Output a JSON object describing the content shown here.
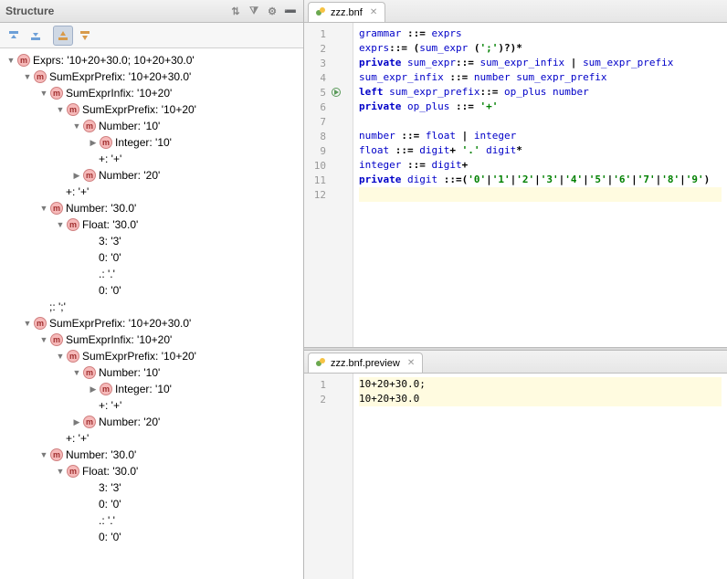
{
  "structure": {
    "title": "Structure",
    "tree": [
      {
        "d": 0,
        "a": "▼",
        "i": "m",
        "label": "Exprs: '10+20+30.0; 10+20+30.0'"
      },
      {
        "d": 1,
        "a": "▼",
        "i": "m",
        "label": "SumExprPrefix: '10+20+30.0'"
      },
      {
        "d": 2,
        "a": "▼",
        "i": "m",
        "label": "SumExprInfix: '10+20'"
      },
      {
        "d": 3,
        "a": "▼",
        "i": "m",
        "label": "SumExprPrefix: '10+20'"
      },
      {
        "d": 4,
        "a": "▼",
        "i": "m",
        "label": "Number: '10'"
      },
      {
        "d": 5,
        "a": "▶",
        "i": "m",
        "label": "Integer: '10'"
      },
      {
        "d": 4,
        "a": "",
        "i": "",
        "label": "+: '+'"
      },
      {
        "d": 4,
        "a": "▶",
        "i": "m",
        "label": "Number: '20'"
      },
      {
        "d": 2,
        "a": "",
        "i": "",
        "label": "+: '+'"
      },
      {
        "d": 2,
        "a": "▼",
        "i": "m",
        "label": "Number: '30.0'"
      },
      {
        "d": 3,
        "a": "▼",
        "i": "m",
        "label": "Float: '30.0'"
      },
      {
        "d": 4,
        "a": "",
        "i": "",
        "label": "3: '3'"
      },
      {
        "d": 4,
        "a": "",
        "i": "",
        "label": "0: '0'"
      },
      {
        "d": 4,
        "a": "",
        "i": "",
        "label": ".: '.'"
      },
      {
        "d": 4,
        "a": "",
        "i": "",
        "label": "0: '0'"
      },
      {
        "d": 1,
        "a": "",
        "i": "",
        "label": ";: ';'"
      },
      {
        "d": 1,
        "a": "▼",
        "i": "m",
        "label": "SumExprPrefix: '10+20+30.0'"
      },
      {
        "d": 2,
        "a": "▼",
        "i": "m",
        "label": "SumExprInfix: '10+20'"
      },
      {
        "d": 3,
        "a": "▼",
        "i": "m",
        "label": "SumExprPrefix: '10+20'"
      },
      {
        "d": 4,
        "a": "▼",
        "i": "m",
        "label": "Number: '10'"
      },
      {
        "d": 5,
        "a": "▶",
        "i": "m",
        "label": "Integer: '10'"
      },
      {
        "d": 4,
        "a": "",
        "i": "",
        "label": "+: '+'"
      },
      {
        "d": 4,
        "a": "▶",
        "i": "m",
        "label": "Number: '20'"
      },
      {
        "d": 2,
        "a": "",
        "i": "",
        "label": "+: '+'"
      },
      {
        "d": 2,
        "a": "▼",
        "i": "m",
        "label": "Number: '30.0'"
      },
      {
        "d": 3,
        "a": "▼",
        "i": "m",
        "label": "Float: '30.0'"
      },
      {
        "d": 4,
        "a": "",
        "i": "",
        "label": "3: '3'"
      },
      {
        "d": 4,
        "a": "",
        "i": "",
        "label": "0: '0'"
      },
      {
        "d": 4,
        "a": "",
        "i": "",
        "label": ".: '.'"
      },
      {
        "d": 4,
        "a": "",
        "i": "",
        "label": "0: '0'"
      }
    ]
  },
  "editor": {
    "tab_label": "zzz.bnf",
    "lines": [
      {
        "n": 1,
        "tokens": [
          [
            "ru",
            "grammar"
          ],
          [
            "op",
            " ::= "
          ],
          [
            "ru",
            "exprs"
          ]
        ]
      },
      {
        "n": 2,
        "tokens": [
          [
            "ru",
            "exprs"
          ],
          [
            "op",
            "::= ("
          ],
          [
            "ru",
            "sum_expr"
          ],
          [
            "op",
            " ("
          ],
          [
            "st",
            "';'"
          ],
          [
            "op",
            ")?)*"
          ]
        ]
      },
      {
        "n": 3,
        "tokens": [
          [
            "kw",
            "private "
          ],
          [
            "ru",
            "sum_expr"
          ],
          [
            "op",
            "::= "
          ],
          [
            "ru",
            "sum_expr_infix"
          ],
          [
            "op",
            " | "
          ],
          [
            "ru",
            "sum_expr_prefix"
          ]
        ]
      },
      {
        "n": 4,
        "tokens": [
          [
            "ru",
            "sum_expr_infix"
          ],
          [
            "op",
            " ::= "
          ],
          [
            "ru",
            "number"
          ],
          [
            "op",
            " "
          ],
          [
            "ru",
            "sum_expr_prefix"
          ]
        ]
      },
      {
        "n": 5,
        "mark": "run",
        "tokens": [
          [
            "kw",
            "left "
          ],
          [
            "ru",
            "sum_expr_prefix"
          ],
          [
            "op",
            "::= "
          ],
          [
            "ru",
            "op_plus"
          ],
          [
            "op",
            " "
          ],
          [
            "ru",
            "number"
          ]
        ]
      },
      {
        "n": 6,
        "tokens": [
          [
            "kw",
            "private "
          ],
          [
            "ru",
            "op_plus"
          ],
          [
            "op",
            " ::= "
          ],
          [
            "st",
            "'+'"
          ]
        ]
      },
      {
        "n": 7,
        "tokens": []
      },
      {
        "n": 8,
        "tokens": [
          [
            "ru",
            "number"
          ],
          [
            "op",
            " ::= "
          ],
          [
            "ru",
            "float"
          ],
          [
            "op",
            " | "
          ],
          [
            "ru",
            "integer"
          ]
        ]
      },
      {
        "n": 9,
        "tokens": [
          [
            "ru",
            "float"
          ],
          [
            "op",
            " ::= "
          ],
          [
            "ru",
            "digit"
          ],
          [
            "op",
            "+ "
          ],
          [
            "st",
            "'.'"
          ],
          [
            "op",
            " "
          ],
          [
            "ru",
            "digit"
          ],
          [
            "op",
            "*"
          ]
        ]
      },
      {
        "n": 10,
        "tokens": [
          [
            "ru",
            "integer"
          ],
          [
            "op",
            " ::= "
          ],
          [
            "ru",
            "digit"
          ],
          [
            "op",
            "+"
          ]
        ]
      },
      {
        "n": 11,
        "tokens": [
          [
            "kw",
            "private "
          ],
          [
            "ru",
            "digit"
          ],
          [
            "op",
            " ::=("
          ],
          [
            "st",
            "'0'"
          ],
          [
            "op",
            "|"
          ],
          [
            "st",
            "'1'"
          ],
          [
            "op",
            "|"
          ],
          [
            "st",
            "'2'"
          ],
          [
            "op",
            "|"
          ],
          [
            "st",
            "'3'"
          ],
          [
            "op",
            "|"
          ],
          [
            "st",
            "'4'"
          ],
          [
            "op",
            "|"
          ],
          [
            "st",
            "'5'"
          ],
          [
            "op",
            "|"
          ],
          [
            "st",
            "'6'"
          ],
          [
            "op",
            "|"
          ],
          [
            "st",
            "'7'"
          ],
          [
            "op",
            "|"
          ],
          [
            "st",
            "'8'"
          ],
          [
            "op",
            "|"
          ],
          [
            "st",
            "'9'"
          ],
          [
            "op",
            ")"
          ]
        ]
      },
      {
        "n": 12,
        "hl": true,
        "tokens": []
      }
    ]
  },
  "preview": {
    "tab_label": "zzz.bnf.preview",
    "lines": [
      {
        "n": 1,
        "hl": true,
        "text": "10+20+30.0;"
      },
      {
        "n": 2,
        "hl": true,
        "text": "10+20+30.0"
      }
    ]
  }
}
